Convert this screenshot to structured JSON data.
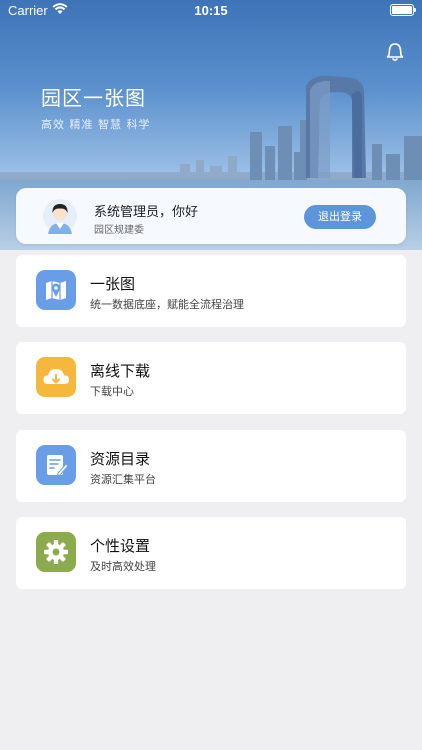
{
  "status_bar": {
    "carrier": "Carrier",
    "time": "10:15"
  },
  "hero": {
    "title": "园区一张图",
    "subtitle": "高效 精准 智慧 科学",
    "notification_icon": "bell-icon"
  },
  "user": {
    "greeting": "系统管理员，你好",
    "organization": "园区规建委",
    "logout_label": "退出登录",
    "avatar_icon": "user-avatar-icon"
  },
  "menu": [
    {
      "title": "一张图",
      "description": "统一数据底座，赋能全流程治理",
      "icon": "map-pin-icon",
      "color": "#6a9de8"
    },
    {
      "title": "离线下载",
      "description": "下载中心",
      "icon": "cloud-download-icon",
      "color": "#f5b83d"
    },
    {
      "title": "资源目录",
      "description": "资源汇集平台",
      "icon": "document-edit-icon",
      "color": "#6a9de8"
    },
    {
      "title": "个性设置",
      "description": "及时高效处理",
      "icon": "gear-icon",
      "color": "#8bab4e"
    }
  ],
  "colors": {
    "primary": "#5d95db",
    "background": "#efeff1",
    "card": "#ffffff"
  }
}
